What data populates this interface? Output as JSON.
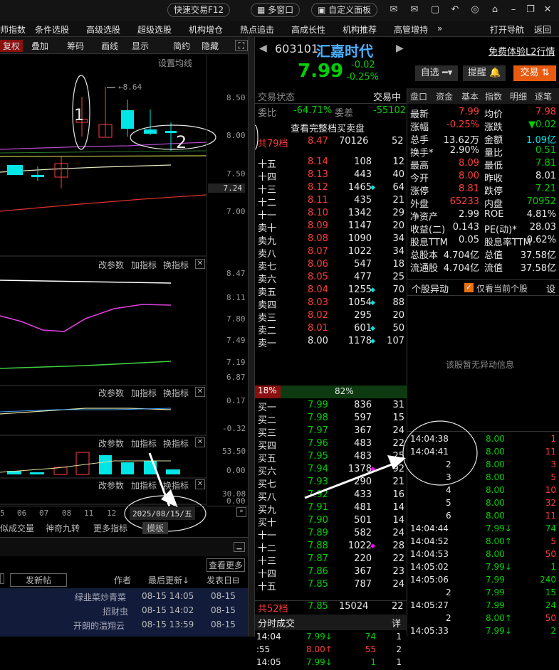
{
  "topbar": {
    "quick_trade": "快速交易F12",
    "multi_window": "多窗口",
    "custom_panel": "自定义面板"
  },
  "menu": [
    "师指数",
    "条件选股",
    "高级选股",
    "超级选股",
    "机构增仓",
    "热点追击",
    "高成长性",
    "机构推荐",
    "高管增持",
    "»",
    "打开导航",
    "返回"
  ],
  "chart_toolbar": {
    "items": [
      "复权",
      "叠加",
      "筹码",
      "画线",
      "显示",
      "简约",
      "隐藏"
    ],
    "ma_label": "设置均线"
  },
  "price_axis": [
    "8.50",
    "8.00",
    "7.50",
    "7.24",
    "7.00"
  ],
  "ind1_axis": [
    "8.47",
    "8.11",
    "7.80",
    "7.49",
    "7.19",
    "6.87"
  ],
  "ind2_axis": [
    "0.17",
    "-0.32"
  ],
  "ind3_axis": [
    "53.50",
    "0.00"
  ],
  "ind4_axis": [
    "30.08",
    "0.00"
  ],
  "panel_tools": {
    "a": "改参数",
    "b": "加指标",
    "c": "换指标"
  },
  "annotations": {
    "high": "8.64",
    "n1": "1",
    "n2": "2"
  },
  "xaxis": {
    "labels": [
      "5",
      "06",
      "07",
      "08",
      "11",
      "12"
    ],
    "date": "2025/08/15/五"
  },
  "bottom_tabs": [
    "似成交量",
    "神奇九转",
    "更多指标",
    "模板"
  ],
  "forum": {
    "more": "查看更多",
    "new_post": "发新帖",
    "author": "作者",
    "last_update": "最后更新",
    "post_date": "发表日",
    "rows": [
      [
        "绿韭菜炒青菜",
        "08-15 14:05",
        "08-15"
      ],
      [
        "招财虫",
        "08-15 14:02",
        "08-15"
      ],
      [
        "开朗的温翔云",
        "08-15 13:59",
        "08-15"
      ]
    ]
  },
  "stock": {
    "code": "603101",
    "name": "汇嘉时代",
    "price": "7.99",
    "change": "-0.02",
    "pct": "-0.25%",
    "free_l2": "免费体验L2行情",
    "btn_watch": "自选",
    "btn_remind": "提醒",
    "btn_trade": "交易"
  },
  "orderbook": {
    "status_label": "交易状态",
    "status": "交易中",
    "wb_label": "委比",
    "wb": "-64.71%",
    "wc_label": "委差",
    "wc": "-55102",
    "full": "查看完整档买卖盘",
    "sell_total": [
      "共79档",
      "8.47",
      "70126",
      "52"
    ],
    "sells": [
      [
        "十五",
        "8.14",
        "108",
        "12",
        ""
      ],
      [
        "十四",
        "8.13",
        "443",
        "40",
        ""
      ],
      [
        "十三",
        "8.12",
        "1465",
        "64",
        "c"
      ],
      [
        "十二",
        "8.11",
        "435",
        "21",
        ""
      ],
      [
        "十一",
        "8.10",
        "1342",
        "29",
        ""
      ],
      [
        "卖十",
        "8.09",
        "1147",
        "20",
        ""
      ],
      [
        "卖九",
        "8.08",
        "1090",
        "34",
        ""
      ],
      [
        "卖八",
        "8.07",
        "1022",
        "34",
        ""
      ],
      [
        "卖七",
        "8.06",
        "547",
        "18",
        ""
      ],
      [
        "卖六",
        "8.05",
        "477",
        "25",
        ""
      ],
      [
        "卖五",
        "8.04",
        "1255",
        "70",
        "c"
      ],
      [
        "卖四",
        "8.03",
        "1054",
        "88",
        "c"
      ],
      [
        "卖三",
        "8.02",
        "295",
        "20",
        ""
      ],
      [
        "卖二",
        "8.01",
        "601",
        "50",
        "c"
      ],
      [
        "卖一",
        "8.00",
        "1178",
        "107",
        "c"
      ]
    ],
    "ratio": [
      "18%",
      "82%"
    ],
    "buys": [
      [
        "买一",
        "7.99",
        "836",
        "31",
        ""
      ],
      [
        "买二",
        "7.98",
        "597",
        "15",
        ""
      ],
      [
        "买三",
        "7.97",
        "367",
        "24",
        ""
      ],
      [
        "买四",
        "7.96",
        "483",
        "22",
        ""
      ],
      [
        "买五",
        "7.95",
        "483",
        "25",
        ""
      ],
      [
        "买六",
        "7.94",
        "1378",
        "92",
        "m"
      ],
      [
        "买七",
        "7.93",
        "290",
        "21",
        ""
      ],
      [
        "买八",
        "7.92",
        "433",
        "16",
        ""
      ],
      [
        "买九",
        "7.91",
        "481",
        "14",
        ""
      ],
      [
        "买十",
        "7.90",
        "501",
        "14",
        ""
      ],
      [
        "十一",
        "7.89",
        "582",
        "24",
        ""
      ],
      [
        "十二",
        "7.88",
        "1022",
        "28",
        "m"
      ],
      [
        "十三",
        "7.87",
        "220",
        "22",
        ""
      ],
      [
        "十四",
        "7.86",
        "367",
        "23",
        ""
      ],
      [
        "十五",
        "7.85",
        "787",
        "24",
        ""
      ]
    ],
    "buy_total": [
      "共52档",
      "7.85",
      "15024",
      "22"
    ]
  },
  "timeshare": {
    "title": "分时成交",
    "detail": "详",
    "rows": [
      [
        "14:04",
        "7.99",
        "↓",
        "74",
        "1"
      ],
      [
        ":55",
        "8.00",
        "↑",
        "55",
        "2"
      ],
      [
        "14:05",
        "7.99",
        "↓",
        "1",
        "1"
      ]
    ]
  },
  "tabs": [
    "盘口",
    "资金",
    "基本",
    "指数",
    "明细",
    "逐笔"
  ],
  "quote": [
    [
      "最新",
      "7.99",
      "r",
      "均价",
      "7.98",
      "r"
    ],
    [
      "涨幅",
      "-0.25%",
      "r",
      "涨跌",
      "▼0.02",
      "g"
    ],
    [
      "总手",
      "13.62万",
      "w",
      "金额",
      "1.09亿",
      "c"
    ],
    [
      "换手*",
      "2.90%",
      "w",
      "量比",
      "0.51",
      "g"
    ],
    [
      "最高",
      "8.09",
      "r",
      "最低",
      "7.81",
      "g"
    ],
    [
      "今开",
      "8.00",
      "r",
      "昨收",
      "8.01",
      "w"
    ],
    [
      "涨停",
      "8.81",
      "r",
      "跌停",
      "7.21",
      "g"
    ],
    [
      "外盘",
      "65233",
      "r",
      "内盘",
      "70952",
      "g"
    ],
    [
      "净资产",
      "2.99",
      "w",
      "ROE",
      "4.81%",
      "w"
    ],
    [
      "收益(二)",
      "0.143",
      "w",
      "PE(动)*",
      "28.03",
      "w"
    ],
    [
      "股息TTM",
      "0.05",
      "w",
      "股息率TTM",
      "0.62%",
      "w"
    ],
    [
      "总股本",
      "4.704亿",
      "w",
      "总值",
      "37.58亿",
      "w"
    ],
    [
      "流通股",
      "4.704亿",
      "w",
      "流值",
      "37.58亿",
      "w"
    ]
  ],
  "anomaly": {
    "title": "个股异动",
    "only_current": "仅看当前个股",
    "settings": "设",
    "empty": "该股暂无异动信息"
  },
  "ticks": [
    [
      "14:04:38",
      "8.00",
      "",
      "1",
      "r"
    ],
    [
      "14:04:41",
      "8.00",
      "",
      "11",
      "r"
    ],
    [
      "2",
      "8.00",
      "",
      "3",
      "r"
    ],
    [
      "3",
      "8.00",
      "",
      "5",
      "r"
    ],
    [
      "4",
      "8.00",
      "",
      "10",
      "r"
    ],
    [
      "5",
      "8.00",
      "",
      "32",
      "r"
    ],
    [
      "6",
      "8.00",
      "",
      "11",
      "r"
    ],
    [
      "14:04:44",
      "7.99",
      "↓",
      "74",
      "g"
    ],
    [
      "14:04:52",
      "8.00",
      "↑",
      "5",
      "r"
    ],
    [
      "14:04:53",
      "8.00",
      "",
      "50",
      "r"
    ],
    [
      "14:05:02",
      "7.99",
      "↓",
      "1",
      "g"
    ],
    [
      "14:05:06",
      "7.99",
      "",
      "240",
      "g"
    ],
    [
      "2",
      "7.99",
      "",
      "15",
      "g"
    ],
    [
      "14:05:27",
      "7.99",
      "",
      "24",
      "g"
    ],
    [
      "2",
      "8.00",
      "↑",
      "50",
      "r"
    ],
    [
      "14:05:33",
      "7.99",
      "↓",
      "2",
      "g"
    ]
  ]
}
